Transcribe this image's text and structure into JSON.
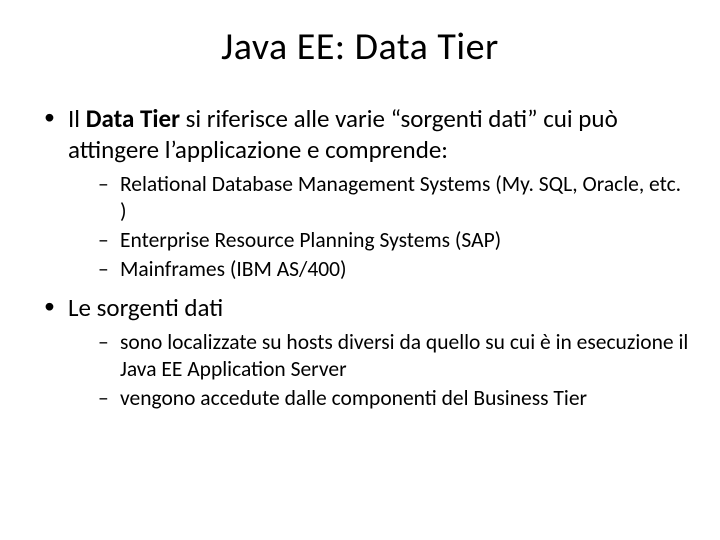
{
  "title": "Java EE: Data Tier",
  "b1": {
    "pre": "Il ",
    "bold": "Data Tier",
    "post": " si riferisce alle varie “sorgenti dati” cui può attingere l’applicazione e comprende:",
    "sub": [
      "Relational Database Management Systems (My. SQL, Oracle, etc. )",
      "Enterprise Resource Planning Systems (SAP)",
      "Mainframes (IBM AS/400)"
    ]
  },
  "b2": {
    "text": "Le sorgenti dati",
    "sub": [
      "sono localizzate su hosts diversi da quello su cui è in esecuzione il Java EE Application Server",
      "vengono accedute dalle componenti del Business Tier"
    ]
  }
}
